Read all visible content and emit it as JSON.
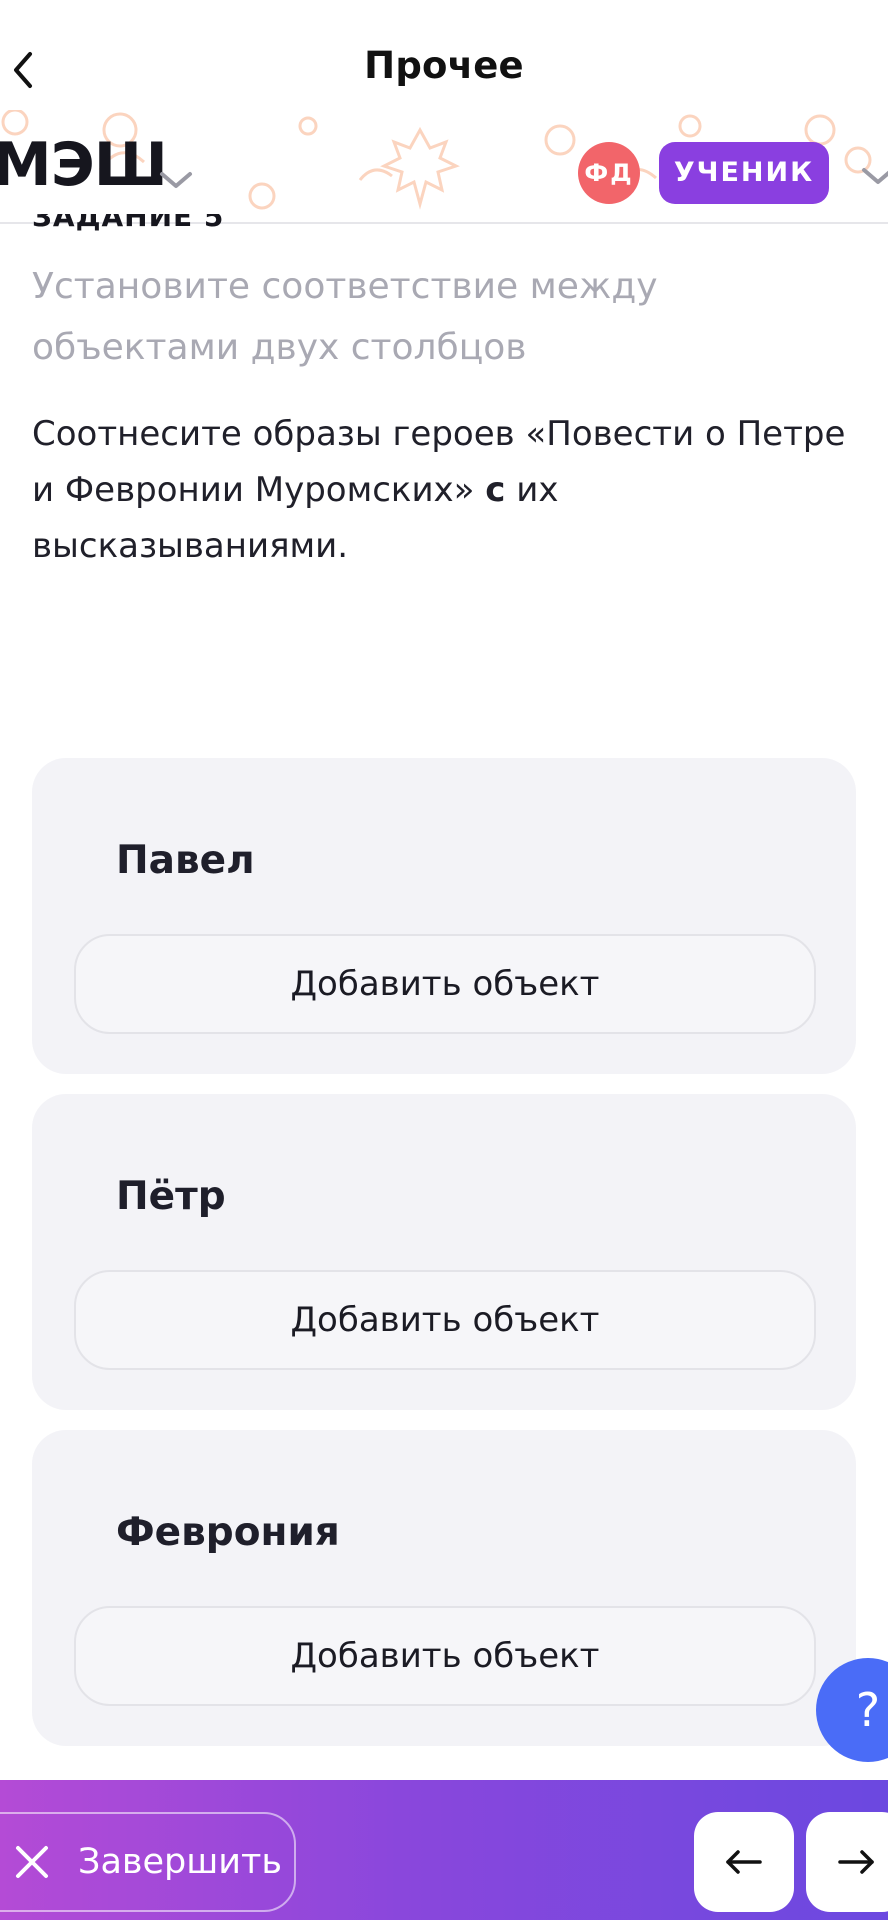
{
  "nav": {
    "title": "Прочее",
    "back_icon": "chevron-left-icon"
  },
  "header": {
    "logo": "МЭШ",
    "avatar_initials": "ФД",
    "role": "УЧЕНИК",
    "colors": {
      "avatar": "#f2656a",
      "role_badge": "#8a3fe0"
    }
  },
  "task": {
    "label": "ЗАДАНИЕ 5",
    "hint": "Установите соответствие между объектами двух столбцов",
    "text_part1": "Соотнесите образы героев «Повести о Петре и Февронии Муромских» ",
    "text_bold": "с",
    "text_part2": " их высказываниями."
  },
  "match_items": [
    {
      "name": "Павел",
      "add_label": "Добавить объект"
    },
    {
      "name": "Пётр",
      "add_label": "Добавить объект"
    },
    {
      "name": "Феврония",
      "add_label": "Добавить объект"
    }
  ],
  "help": {
    "label": "?"
  },
  "bottom": {
    "finish_label": "Завершить",
    "prev_icon": "arrow-left-icon",
    "next_icon": "arrow-right-icon"
  }
}
